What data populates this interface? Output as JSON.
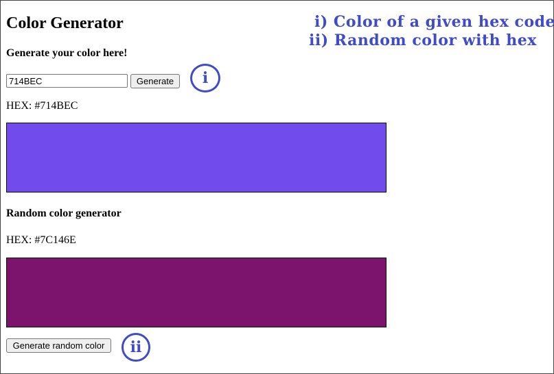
{
  "header": {
    "title": "Color Generator"
  },
  "annotations": {
    "note1": "i) Color of a given hex code",
    "note2": "ii) Random color with hex",
    "badge1": "i",
    "badge2": "ii"
  },
  "generator": {
    "subtitle": "Generate your color here!",
    "input_value": "714BEC",
    "button_label": "Generate",
    "hex_text": "HEX: #714BEC",
    "swatch_color": "#714BEC"
  },
  "random": {
    "subtitle": "Random color generator",
    "hex_text": "HEX: #7C146E",
    "swatch_color": "#7C146E",
    "button_label": "Generate random color"
  },
  "colors": {
    "accent": "#3F4BC8",
    "border": "#444444"
  }
}
